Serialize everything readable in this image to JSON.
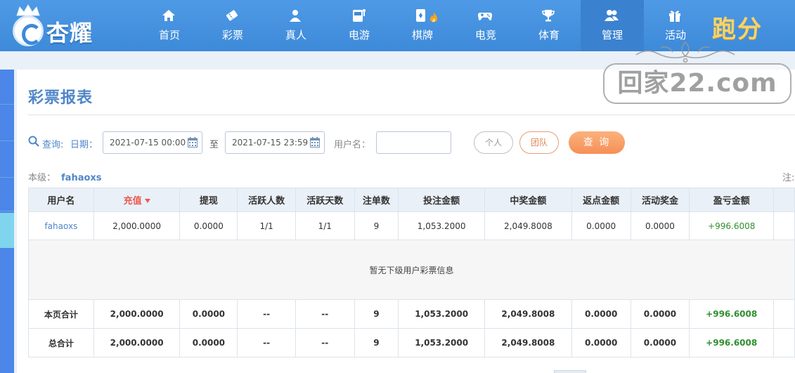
{
  "brand": {
    "name": "杏耀",
    "paofen": "跑分"
  },
  "watermark": {
    "text": "回家22.com"
  },
  "nav": [
    {
      "label": "首页",
      "icon": "home-icon"
    },
    {
      "label": "彩票",
      "icon": "lottery-ticket-icon"
    },
    {
      "label": "真人",
      "icon": "live-dealer-icon"
    },
    {
      "label": "电游",
      "icon": "slot-machine-icon"
    },
    {
      "label": "棋牌",
      "icon": "card-icon"
    },
    {
      "label": "电竞",
      "icon": "gamepad-icon"
    },
    {
      "label": "体育",
      "icon": "trophy-icon"
    },
    {
      "label": "管理",
      "icon": "users-icon",
      "active": true
    },
    {
      "label": "活动",
      "icon": "gift-icon"
    }
  ],
  "page": {
    "title": "彩票报表"
  },
  "filter": {
    "query_label": "查询:",
    "date_label": "日期：",
    "start_date": "2021-07-15 00:00",
    "to_label": "至",
    "end_date": "2021-07-15 23:59",
    "username_label": "用户名：",
    "username_value": "",
    "personal_button": "个人",
    "team_button": "团队",
    "query_button": "查 询"
  },
  "level": {
    "label": "本级：",
    "username": "fahaoxs"
  },
  "note": "注:",
  "table": {
    "headers": [
      "用户名",
      "充值",
      "提现",
      "活跃人数",
      "活跃天数",
      "注单数",
      "投注金额",
      "中奖金额",
      "返点金额",
      "活动奖金",
      "盈亏金额"
    ],
    "rows": [
      [
        "fahaoxs",
        "2,000.0000",
        "0.0000",
        "1/1",
        "1/1",
        "9",
        "1,053.2000",
        "2,049.8008",
        "0.0000",
        "0.0000",
        "+996.6008"
      ]
    ],
    "empty_message": "暂无下级用户彩票信息",
    "page_total": [
      "本页合计",
      "2,000.0000",
      "0.0000",
      "--",
      "--",
      "9",
      "1,053.2000",
      "2,049.8008",
      "0.0000",
      "0.0000",
      "+996.6008"
    ],
    "grand_total": [
      "总合计",
      "2,000.0000",
      "0.0000",
      "--",
      "--",
      "9",
      "1,053.2000",
      "2,049.8008",
      "0.0000",
      "0.0000",
      "+996.6008"
    ]
  },
  "colors": {
    "nav_bg": "#3d8ad9",
    "title": "#4f86c9",
    "sorted_header": "#ea5a4f",
    "profit": "#2f8f2f",
    "query_button": "#f58f56"
  }
}
